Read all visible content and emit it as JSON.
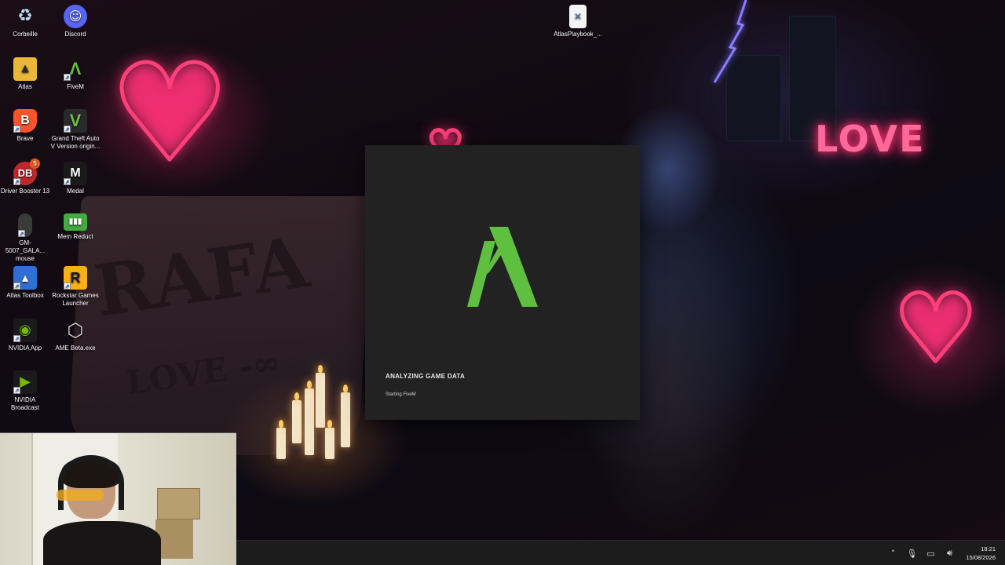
{
  "desktop": {
    "icons": [
      {
        "label": "Corbeille",
        "icon": "recycle-bin-icon"
      },
      {
        "label": "Discord",
        "icon": "discord-icon"
      },
      {
        "label": "AtlasPlaybook_...",
        "icon": "file-icon"
      },
      {
        "label": "Atlas",
        "icon": "folder-icon"
      },
      {
        "label": "FiveM",
        "icon": "fivem-icon"
      },
      {
        "label": "Brave",
        "icon": "brave-icon"
      },
      {
        "label": "Grand Theft Auto V Version origin...",
        "icon": "gta-v-icon"
      },
      {
        "label": "Driver Booster 13",
        "icon": "driver-booster-icon",
        "badge": "5"
      },
      {
        "label": "Medal",
        "icon": "medal-icon"
      },
      {
        "label": "GM-5007_GALA... mouse",
        "icon": "mouse-icon"
      },
      {
        "label": "Mem Reduct",
        "icon": "mem-reduct-icon"
      },
      {
        "label": "Atlas Toolbox",
        "icon": "toolbox-icon"
      },
      {
        "label": "Rockstar Games Launcher",
        "icon": "rockstar-icon"
      },
      {
        "label": "NVIDIA App",
        "icon": "nvidia-icon"
      },
      {
        "label": "AME Beta.exe",
        "icon": "ame-icon"
      },
      {
        "label": "NVIDIA Broadcast",
        "icon": "nvidia-broadcast-icon"
      }
    ]
  },
  "wallpaper": {
    "neon_text": "LOVE",
    "graffiti_name": "RAFA",
    "graffiti_love": "LOVE -∞"
  },
  "splash": {
    "status": "ANALYZING GAME DATA",
    "substatus": "Starting FiveM",
    "logo_color": "#5fbf3f",
    "background": "#222222"
  },
  "taskbar": {
    "time": "18:21",
    "date": "15/08/2026",
    "tray_icons": [
      "chevron-up-icon",
      "microphone-icon",
      "display-icon",
      "volume-icon"
    ]
  }
}
